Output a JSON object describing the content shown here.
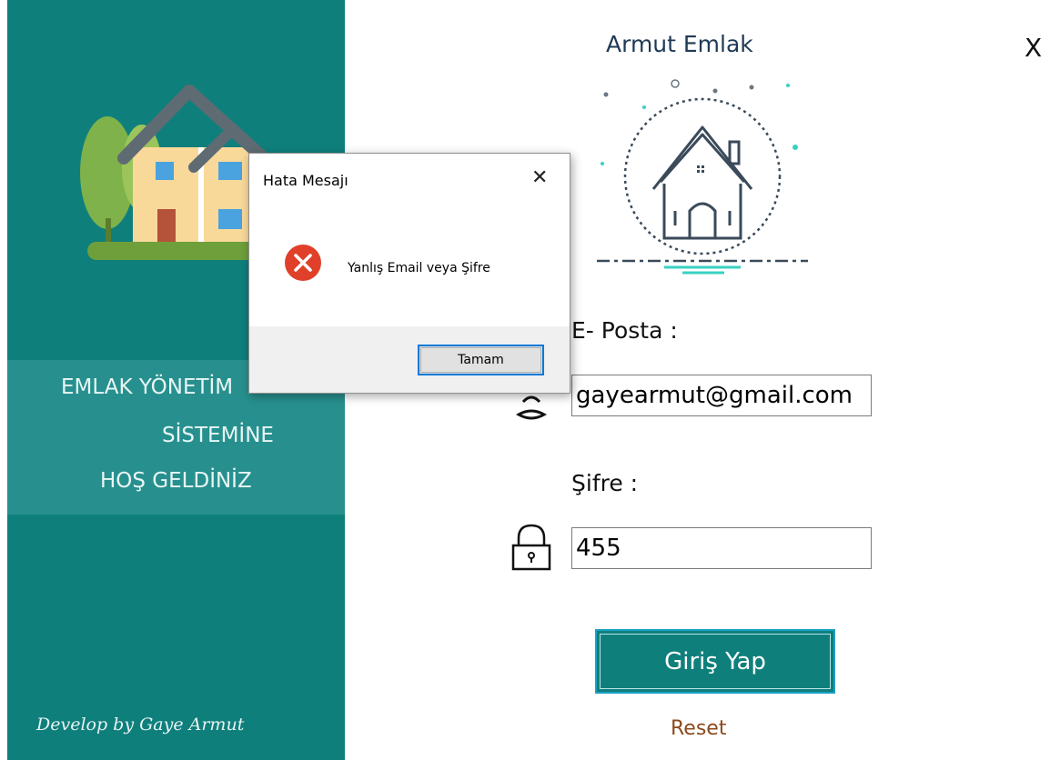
{
  "app": {
    "brand_title": "Armut Emlak",
    "close_glyph": "X"
  },
  "welcome": {
    "line1": "EMLAK YÖNETİM",
    "line2": "SİSTEMİNE",
    "line3": "HOŞ GELDİNİZ",
    "credit": "Develop by Gaye Armut"
  },
  "form": {
    "email_label": "E- Posta :",
    "email_value": "gayearmut@gmail.com",
    "password_label": "Şifre :",
    "password_value": "455",
    "login_button": "Giriş Yap",
    "reset_link": "Reset"
  },
  "dialog": {
    "title": "Hata Mesajı",
    "close_glyph": "✕",
    "message": "Yanlış Email veya Şifre",
    "ok_button": "Tamam",
    "icon": "error-icon"
  },
  "colors": {
    "panel_teal": "#0f7f7c",
    "band_teal": "#27908e",
    "error_red": "#e0402a",
    "reset_brown": "#8b4a1d",
    "focus_blue": "#0078d7"
  }
}
